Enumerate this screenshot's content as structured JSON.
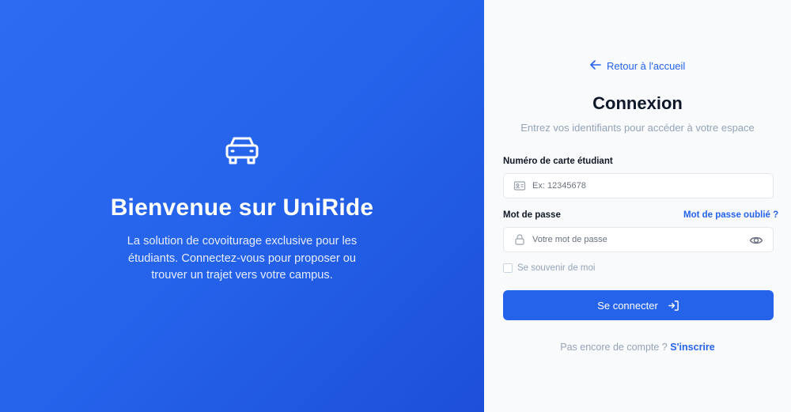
{
  "hero": {
    "title": "Bienvenue sur UniRide",
    "description": "La solution de covoiturage exclusive pour les étudiants. Connectez-vous pour proposer ou trouver un trajet vers votre campus.",
    "icon": "car-icon"
  },
  "login": {
    "back_link": "Retour à l'accueil",
    "title": "Connexion",
    "subtitle": "Entrez vos identifiants pour accéder à votre espace",
    "card_label": "Numéro de carte étudiant",
    "card_placeholder": "Ex: 12345678",
    "password_label": "Mot de passe",
    "forgot_link": "Mot de passe oublié ?",
    "password_placeholder": "Votre mot de passe",
    "remember_label": "Se souvenir de moi",
    "submit_label": "Se connecter",
    "signup_prompt": "Pas encore de compte ?",
    "signup_link": "S'inscrire"
  },
  "colors": {
    "accent": "#2563eb",
    "panel_bg": "#f8fafc"
  }
}
